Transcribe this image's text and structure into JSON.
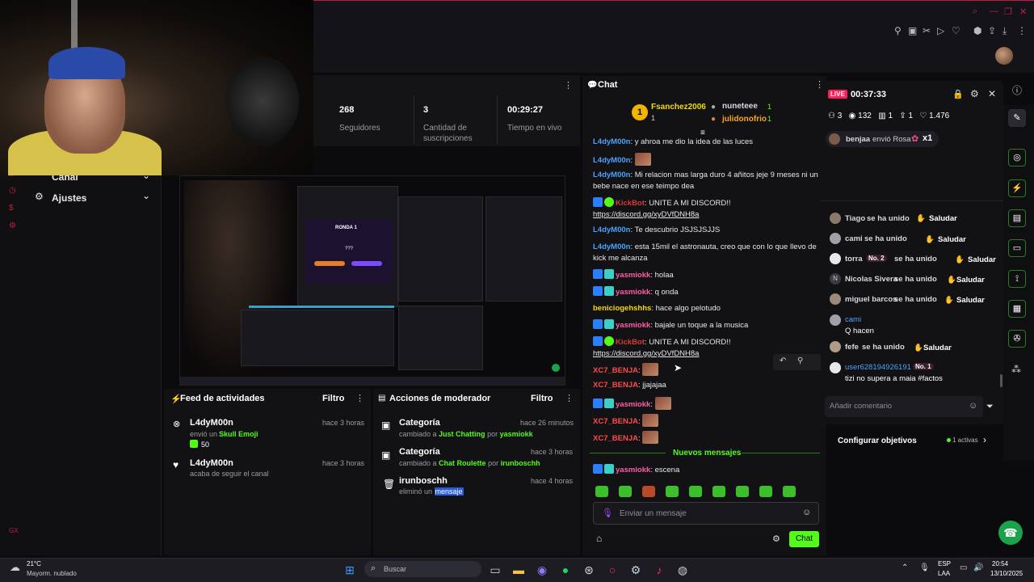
{
  "stats": [
    {
      "value": "268",
      "label": "Seguidores"
    },
    {
      "value": "3",
      "label": "Cantidad de suscripciones"
    },
    {
      "value": "00:29:27",
      "label": "Tiempo en vivo"
    }
  ],
  "nav": {
    "canal": "Canal",
    "ajustes": "Ajustes"
  },
  "activity_feed": {
    "title": "Feed de actividades",
    "filter": "Filtro",
    "items": [
      {
        "name": "L4dyM00n",
        "text_pre": "envió un",
        "highlight": "Skull Emoji",
        "amount": "50",
        "time": "hace 3 horas"
      },
      {
        "name": "L4dyM00n",
        "text_pre": "acaba de seguir el canal",
        "highlight": "",
        "amount": "",
        "time": "hace 3 horas"
      }
    ]
  },
  "mod_actions": {
    "title": "Acciones de moderador",
    "filter": "Filtro",
    "items": [
      {
        "title": "Categoría",
        "pre": "cambiado a",
        "target": "Just Chatting",
        "by": "por",
        "user": "yasmiokk",
        "time": "hace 26 minutos"
      },
      {
        "title": "Categoría",
        "pre": "cambiado a",
        "target": "Chat Roulette",
        "by": "por",
        "user": "irunboschh",
        "time": "hace 3 horas"
      },
      {
        "title": "irunboschh",
        "pre": "eliminó un",
        "target": "mensaje",
        "by": "",
        "user": "",
        "time": "hace 4 horas"
      }
    ]
  },
  "chat": {
    "title": "Chat",
    "gifters": {
      "first": "Fsanchez2006",
      "first_count": "1",
      "second": "nuneteee",
      "second_count": "1",
      "third": "julidonofrio",
      "third_count": "1"
    },
    "messages": [
      {
        "user": "L4dyM00n",
        "text": "y ahroa me dio la idea de las luces",
        "color": "blue"
      },
      {
        "user": "L4dyM00n",
        "text": "",
        "color": "blue",
        "emote": true
      },
      {
        "user": "L4dyM00n",
        "text": "Mi relacion mas larga duro 4 añitos jeje 9 meses ni un bebe nace en ese teimpo dea",
        "color": "blue"
      },
      {
        "user": "KickBot",
        "text": "UNITE A MI DISCORD!!",
        "link": "https://discord.gg/xyDVfDNH8a",
        "color": "green"
      },
      {
        "user": "L4dyM00n",
        "text": "Te descubrio JSJSJSJJS",
        "color": "blue"
      },
      {
        "user": "L4dyM00n",
        "text": "esta 15mil el astronauta, creo que con lo que llevo de kick me alcanza",
        "color": "blue"
      },
      {
        "user": "yasmiokk",
        "text": "holaa",
        "color": "pink"
      },
      {
        "user": "yasmiokk",
        "text": "q onda",
        "color": "pink"
      },
      {
        "user": "beniciogehshhs",
        "text": "hace algo pelotudo",
        "color": "yellow"
      },
      {
        "user": "yasmiokk",
        "text": "bajale un toque a la musica",
        "color": "pink"
      },
      {
        "user": "KickBot",
        "text": "UNITE A MI DISCORD!!",
        "link": "https://discord.gg/xyDVfDNH8a",
        "color": "green"
      },
      {
        "user": "XC7_BENJA",
        "text": "",
        "color": "red",
        "emote": true
      },
      {
        "user": "XC7_BENJA",
        "text": "jjajajaa",
        "color": "red"
      },
      {
        "user": "yasmiokk",
        "text": "",
        "color": "pink",
        "emote": true
      },
      {
        "user": "XC7_BENJA",
        "text": "",
        "color": "red",
        "emote": true
      },
      {
        "user": "XC7_BENJA",
        "text": "",
        "color": "red",
        "emote": true
      }
    ],
    "new_messages": "Nuevos mensajes",
    "last": {
      "user": "yasmiokk",
      "text": "escena"
    },
    "input_placeholder": "Enviar un mensaje",
    "send_label": "Chat"
  },
  "mod_panel": {
    "live": "LIVE",
    "timer": "00:37:33",
    "counts": {
      "a": "3",
      "viewers": "132",
      "b": "1",
      "c": "1",
      "likes": "1.476"
    },
    "gift": {
      "user": "benjaa",
      "text": "envió Rosa",
      "mult": "x1"
    },
    "joins": [
      {
        "name": "Tiago",
        "text": "se ha unido",
        "btn": "Saludar",
        "tag": ""
      },
      {
        "name": "cami",
        "text": "se ha unido",
        "btn": "Saludar",
        "tag": ""
      },
      {
        "name": "torra",
        "text": "se ha unido",
        "btn": "Saludar",
        "tag": "No. 2"
      },
      {
        "name": "Nicolas Sivera",
        "text": "se ha unido",
        "btn": "Saludar",
        "tag": ""
      },
      {
        "name": "miguel barcos",
        "text": "se ha unido",
        "btn": "Saludar",
        "tag": ""
      }
    ],
    "comment1": {
      "name": "cami",
      "text": "Q hacen"
    },
    "join_fefe": {
      "name": "fefe",
      "text": "se ha unido",
      "btn": "Saludar"
    },
    "comment2": {
      "name": "user628194926191",
      "tag": "No. 1",
      "text": "tizi no supera a maia #factos"
    },
    "input_placeholder": "Añadir comentario"
  },
  "objectives": {
    "label": "Configurar objetivos",
    "status": "1 activas"
  },
  "taskbar": {
    "weather_temp": "21°C",
    "weather_desc": "Mayorm. nublado",
    "search": "Buscar",
    "lang": "ESP",
    "lang2": "LAA",
    "time": "20:54",
    "date": "13/10/2025"
  },
  "preview": {
    "round": "RONDA 1",
    "q": "???"
  }
}
